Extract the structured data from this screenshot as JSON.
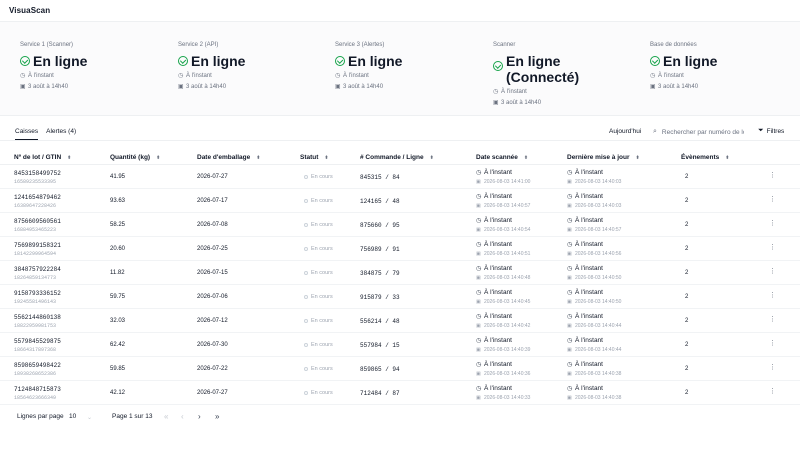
{
  "app": {
    "title": "VisuaScan"
  },
  "status_cards": [
    {
      "label": "Service 1 (Scanner)",
      "state": "En ligne",
      "since": "À l'instant",
      "date": "3 août à 14h40"
    },
    {
      "label": "Service 2 (API)",
      "state": "En ligne",
      "since": "À l'instant",
      "date": "3 août à 14h40"
    },
    {
      "label": "Service 3 (Alertes)",
      "state": "En ligne",
      "since": "À l'instant",
      "date": "3 août à 14h40"
    },
    {
      "label": "Scanner",
      "state": "En ligne (Connecté)",
      "since": "À l'instant",
      "date": "3 août à 14h40"
    },
    {
      "label": "Base de données",
      "state": "En ligne",
      "since": "À l'instant",
      "date": "3 août à 14h40"
    }
  ],
  "tabs": [
    {
      "label": "Caisses",
      "active": true
    },
    {
      "label": "Alertes (4)",
      "active": false
    }
  ],
  "toolbar": {
    "today_label": "Aujourd'hui",
    "search_placeholder": "Rechercher par numéro de lo",
    "filters_label": "Filtres"
  },
  "columns": {
    "lot": "Nº de lot / GTIN",
    "qty": "Quantité (kg)",
    "packed": "Date d'emballage",
    "status": "Statut",
    "order": "# Commande / Ligne",
    "scanned": "Date scannée",
    "updated": "Dernière mise à jour",
    "events": "Évènements"
  },
  "rows": [
    {
      "lot": "8453158499752",
      "gtin": "16589235533395",
      "qty": "41.95",
      "packed": "2026-07-27",
      "status": "En cours",
      "order": "845315 / 84",
      "scanned_rel": "À l'instant",
      "scanned_abs": "2026-08-03 14:41:00",
      "updated_rel": "À l'instant",
      "updated_abs": "2026-08-03 14:40:03",
      "events": "2"
    },
    {
      "lot": "1241654879462",
      "gtin": "16389647228426",
      "qty": "93.63",
      "packed": "2026-07-17",
      "status": "En cours",
      "order": "124165 / 48",
      "scanned_rel": "À l'instant",
      "scanned_abs": "2026-08-03 14:40:57",
      "updated_rel": "À l'instant",
      "updated_abs": "2026-08-03 14:40:03",
      "events": "2"
    },
    {
      "lot": "8756609560561",
      "gtin": "16884953465223",
      "qty": "58.25",
      "packed": "2026-07-08",
      "status": "En cours",
      "order": "875660 / 95",
      "scanned_rel": "À l'instant",
      "scanned_abs": "2026-08-03 14:40:54",
      "updated_rel": "À l'instant",
      "updated_abs": "2026-08-03 14:40:57",
      "events": "2"
    },
    {
      "lot": "7569899158321",
      "gtin": "18142299964594",
      "qty": "20.60",
      "packed": "2026-07-25",
      "status": "En cours",
      "order": "756989 / 91",
      "scanned_rel": "À l'instant",
      "scanned_abs": "2026-08-03 14:40:51",
      "updated_rel": "À l'instant",
      "updated_abs": "2026-08-03 14:40:56",
      "events": "2"
    },
    {
      "lot": "3848757922284",
      "gtin": "18264859134773",
      "qty": "11.82",
      "packed": "2026-07-15",
      "status": "En cours",
      "order": "384875 / 79",
      "scanned_rel": "À l'instant",
      "scanned_abs": "2026-08-03 14:40:48",
      "updated_rel": "À l'instant",
      "updated_abs": "2026-08-03 14:40:50",
      "events": "2"
    },
    {
      "lot": "9158793336152",
      "gtin": "19245581496143",
      "qty": "59.75",
      "packed": "2026-07-06",
      "status": "En cours",
      "order": "915879 / 33",
      "scanned_rel": "À l'instant",
      "scanned_abs": "2026-08-03 14:40:45",
      "updated_rel": "À l'instant",
      "updated_abs": "2026-08-03 14:40:50",
      "events": "2"
    },
    {
      "lot": "5562144860138",
      "gtin": "18822959981753",
      "qty": "32.03",
      "packed": "2026-07-12",
      "status": "En cours",
      "order": "556214 / 48",
      "scanned_rel": "À l'instant",
      "scanned_abs": "2026-08-03 14:40:42",
      "updated_rel": "À l'instant",
      "updated_abs": "2026-08-03 14:40:44",
      "events": "2"
    },
    {
      "lot": "5579845529875",
      "gtin": "18664317897368",
      "qty": "62.42",
      "packed": "2026-07-30",
      "status": "En cours",
      "order": "557984 / 15",
      "scanned_rel": "À l'instant",
      "scanned_abs": "2026-08-03 14:40:39",
      "updated_rel": "À l'instant",
      "updated_abs": "2026-08-03 14:40:44",
      "events": "2"
    },
    {
      "lot": "8598659498422",
      "gtin": "18938268652386",
      "qty": "59.85",
      "packed": "2026-07-22",
      "status": "En cours",
      "order": "859865 / 94",
      "scanned_rel": "À l'instant",
      "scanned_abs": "2026-08-03 14:40:36",
      "updated_rel": "À l'instant",
      "updated_abs": "2026-08-03 14:40:38",
      "events": "2"
    },
    {
      "lot": "7124848715873",
      "gtin": "18564623666349",
      "qty": "42.12",
      "packed": "2026-07-27",
      "status": "En cours",
      "order": "712484 / 87",
      "scanned_rel": "À l'instant",
      "scanned_abs": "2026-08-03 14:40:33",
      "updated_rel": "À l'instant",
      "updated_abs": "2026-08-03 14:40:38",
      "events": "2"
    }
  ],
  "pagination": {
    "rows_label": "Lignes par page",
    "rows_value": "10",
    "page_text": "Page 1 sur 13"
  }
}
